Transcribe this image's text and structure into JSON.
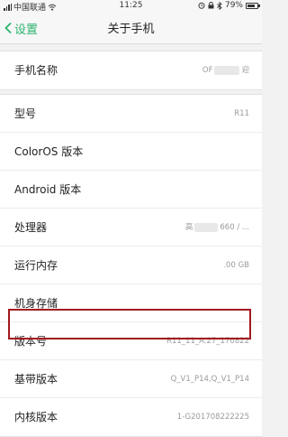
{
  "status_bar": {
    "carrier": "中国联通",
    "time": "11:25",
    "battery_percent": "79%",
    "battery_level": 0.79
  },
  "nav": {
    "back_label": "设置",
    "title": "关于手机"
  },
  "device_name": {
    "label": "手机名称",
    "value_prefix": "OF",
    "value_suffix": "迎"
  },
  "rows": [
    {
      "label": "型号",
      "value": "R11"
    },
    {
      "label": "ColorOS 版本",
      "value": ""
    },
    {
      "label": "Android 版本",
      "value": ""
    },
    {
      "label": "处理器",
      "value_prefix": "高",
      "value_suffix": "660 / ..."
    },
    {
      "label": "运行内存",
      "value": ".00 GB"
    },
    {
      "label": "机身存储",
      "value": ""
    },
    {
      "label": "版本号",
      "value": "R11_11_A.27_170822"
    },
    {
      "label": "基带版本",
      "value": "Q_V1_P14,Q_V1_P14"
    },
    {
      "label": "内核版本",
      "value": "1-G201708222225"
    }
  ],
  "colors": {
    "accent": "#2bb36e",
    "highlight": "#a3181e",
    "background": "#f2f2f2"
  }
}
